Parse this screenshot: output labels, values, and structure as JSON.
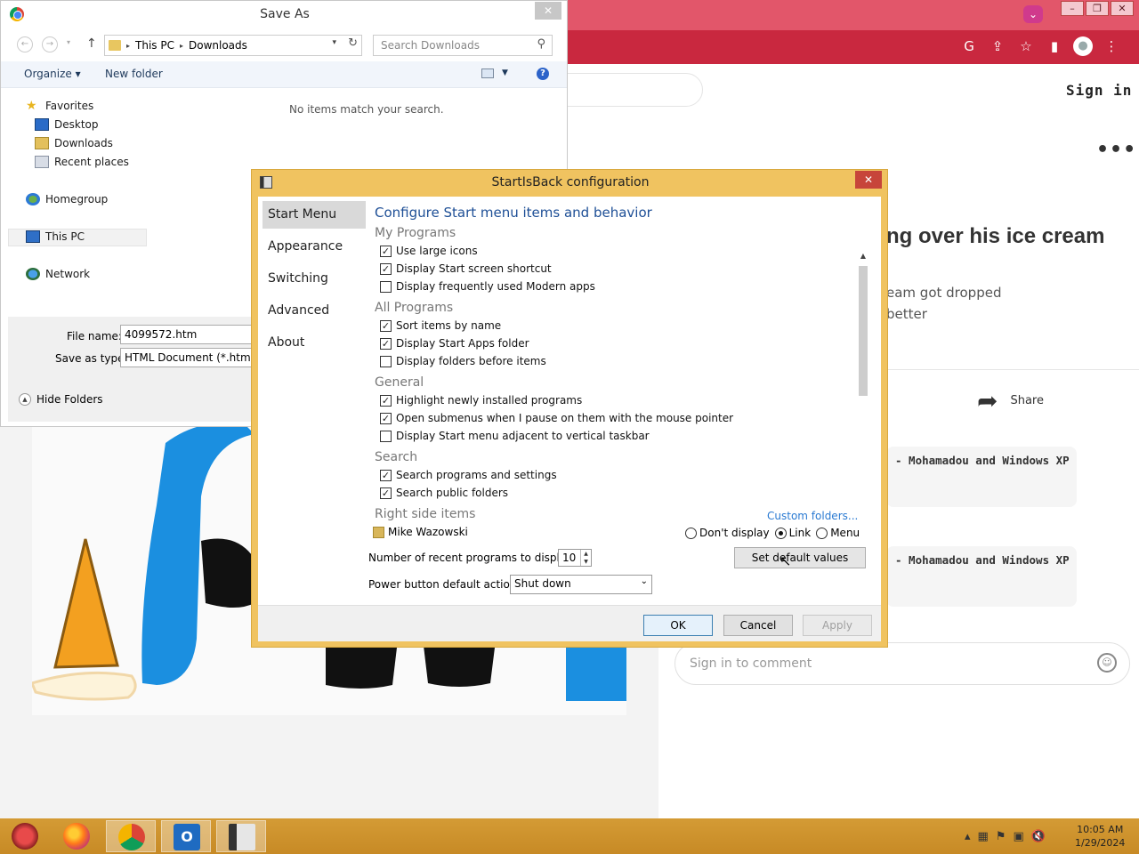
{
  "browser": {
    "sign_in": "Sign in",
    "more": "•••",
    "post_title": "ng over his ice cream",
    "post_desc_line1": "eam got dropped",
    "post_desc_line2": "better",
    "share_label": "Share",
    "related": [
      "- Mohamadou and Windows XP",
      "- Mohamadou and Windows XP"
    ],
    "comment_placeholder": "Sign in to comment",
    "accent_color": "#c9283f"
  },
  "save_as": {
    "title": "Save As",
    "close": "✕",
    "address": [
      "This PC",
      "Downloads"
    ],
    "search_placeholder": "Search Downloads",
    "organize": "Organize ▾",
    "new_folder": "New folder",
    "nav": [
      "Favorites",
      "Desktop",
      "Downloads",
      "Recent places",
      "Homegroup",
      "This PC",
      "Network"
    ],
    "empty_message": "No items match your search.",
    "file_name_label": "File name:",
    "file_name_value": "4099572.htm",
    "save_type_label": "Save as type:",
    "save_type_value": "HTML Document (*.htm)",
    "hide_folders": "Hide Folders"
  },
  "startisback": {
    "title": "StartIsBack configuration",
    "close": "✕",
    "tabs": [
      "Start Menu",
      "Appearance",
      "Switching",
      "Advanced",
      "About"
    ],
    "active_tab": "Start Menu",
    "heading": "Configure Start menu items and behavior",
    "groups": {
      "my_programs": "My Programs",
      "all_programs": "All Programs",
      "general": "General",
      "search": "Search",
      "right_side": "Right side items"
    },
    "options": [
      {
        "label": "Use large icons",
        "checked": true
      },
      {
        "label": "Display Start screen shortcut",
        "checked": true
      },
      {
        "label": "Display frequently used Modern apps",
        "checked": false
      },
      {
        "label": "Sort items by name",
        "checked": true
      },
      {
        "label": "Display Start Apps folder",
        "checked": true
      },
      {
        "label": "Display folders before items",
        "checked": false
      },
      {
        "label": "Highlight newly installed programs",
        "checked": true
      },
      {
        "label": "Open submenus when I pause on them with the mouse pointer",
        "checked": true
      },
      {
        "label": "Display Start menu adjacent to vertical taskbar",
        "checked": false
      },
      {
        "label": "Search programs and settings",
        "checked": true
      },
      {
        "label": "Search public folders",
        "checked": true
      }
    ],
    "custom_folders": "Custom folders...",
    "right_side_item": "Mike Wazowski",
    "radios": [
      {
        "label": "Don't display",
        "selected": false
      },
      {
        "label": "Link",
        "selected": true
      },
      {
        "label": "Menu",
        "selected": false
      }
    ],
    "recent_label": "Number of recent programs to display:",
    "recent_value": "10",
    "set_default": "Set default values",
    "power_label": "Power button default action:",
    "power_value": "Shut down",
    "ok": "OK",
    "cancel": "Cancel",
    "apply": "Apply"
  },
  "taskbar": {
    "apps": [
      "startisback-orb",
      "firefox",
      "chrome",
      "outlook",
      "startisback-config"
    ],
    "time": "10:05 AM",
    "date": "1/29/2024"
  }
}
